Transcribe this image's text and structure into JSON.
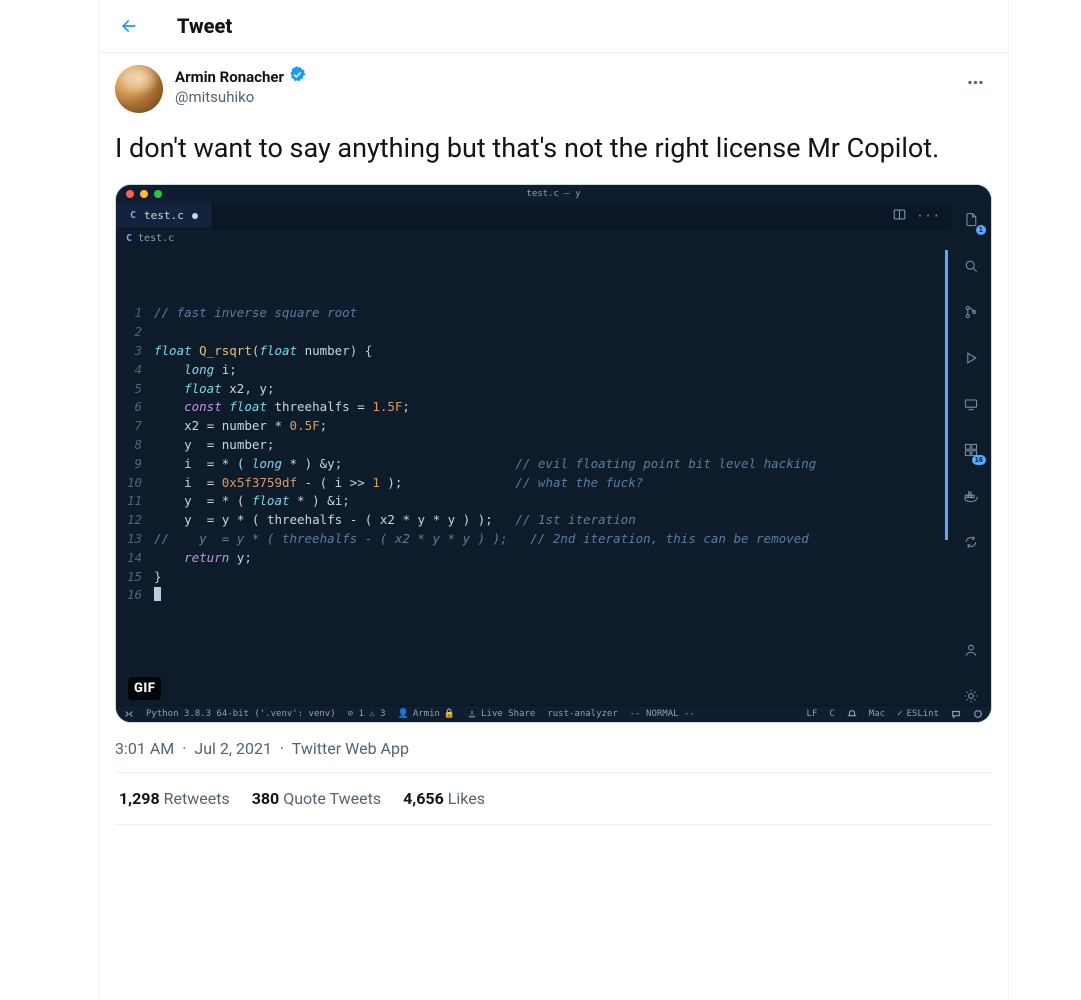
{
  "header": {
    "title": "Tweet"
  },
  "author": {
    "name": "Armin Ronacher",
    "handle": "@mitsuhiko",
    "verified": true
  },
  "tweet_text": "I don't want to say anything but that's not the right license Mr Copilot.",
  "media": {
    "badge": "GIF",
    "window_title": "test.c — y",
    "tab": {
      "lang_badge": "C",
      "filename": "test.c",
      "modified": true
    },
    "breadcrumb": {
      "lang_badge": "C",
      "filename": "test.c"
    },
    "right_rail_badge": "16",
    "status_bar": {
      "remote_icon": true,
      "python": "Python 3.8.3 64-bit ('.venv': venv)",
      "problems": "⊘ 1 ⚠ 3",
      "user": "Armin",
      "live_share": "Live Share",
      "rust": "rust-analyzer",
      "mode": "-- NORMAL --",
      "encoding": "LF",
      "lang": "C",
      "bell_icon": true,
      "mac": "Mac",
      "eslint": "ESLint"
    },
    "code_lines": [
      {
        "n": 1,
        "html": "<span class='cm'>// fast inverse square root</span>"
      },
      {
        "n": 2,
        "html": ""
      },
      {
        "n": 3,
        "html": "<span class='ty'>float</span> <span class='fn'>Q_rsqrt</span>(<span class='ty'>float</span> <span class='id'>number</span>) {"
      },
      {
        "n": 4,
        "html": "    <span class='ty'>long</span> <span class='id'>i</span>;"
      },
      {
        "n": 5,
        "html": "    <span class='ty'>float</span> <span class='id'>x2</span>, <span class='id'>y</span>;"
      },
      {
        "n": 6,
        "html": "    <span class='kw'>const</span> <span class='ty'>float</span> <span class='id'>threehalfs</span> <span class='op'>=</span> <span class='num'>1.5F</span>;"
      },
      {
        "n": 7,
        "html": "    <span class='id'>x2</span> <span class='op'>=</span> <span class='id'>number</span> <span class='op'>*</span> <span class='num'>0.5F</span>;"
      },
      {
        "n": 8,
        "html": "    <span class='id'>y</span>  <span class='op'>=</span> <span class='id'>number</span>;"
      },
      {
        "n": 9,
        "html": "    <span class='id'>i</span>  <span class='op'>=</span> <span class='op'>* (</span> <span class='ty'>long</span> <span class='op'>* ) &amp;</span><span class='id'>y</span>;                       <span class='cm'>// evil floating point bit level hacking</span>"
      },
      {
        "n": 10,
        "html": "    <span class='id'>i</span>  <span class='op'>=</span> <span class='num'>0x5f3759df</span> <span class='op'>- (</span> <span class='id'>i</span> <span class='op'>&gt;&gt;</span> <span class='num'>1</span> <span class='op'>);</span>               <span class='cm'>// what the fuck?</span>"
      },
      {
        "n": 11,
        "html": "    <span class='id'>y</span>  <span class='op'>=</span> <span class='op'>* (</span> <span class='ty'>float</span> <span class='op'>* ) &amp;</span><span class='id'>i</span>;"
      },
      {
        "n": 12,
        "html": "    <span class='id'>y</span>  <span class='op'>=</span> <span class='id'>y</span> <span class='op'>* (</span> <span class='id'>threehalfs</span> <span class='op'>- (</span> <span class='id'>x2</span> <span class='op'>*</span> <span class='id'>y</span> <span class='op'>*</span> <span class='id'>y</span> <span class='op'>) );</span>   <span class='cm'>// 1st iteration</span>"
      },
      {
        "n": 13,
        "html": "<span class='cm'>//    y  = y * ( threehalfs - ( x2 * y * y ) );   // 2nd iteration, this can be removed</span>"
      },
      {
        "n": 14,
        "html": "    <span class='kw'>return</span> <span class='id'>y</span>;"
      },
      {
        "n": 15,
        "html": "}"
      },
      {
        "n": 16,
        "html": "<span class='cursor-block'></span>"
      }
    ]
  },
  "meta": {
    "time": "3:01 AM",
    "date": "Jul 2, 2021",
    "source": "Twitter Web App"
  },
  "stats": {
    "retweets_count": "1,298",
    "retweets_label": "Retweets",
    "quotes_count": "380",
    "quotes_label": "Quote Tweets",
    "likes_count": "4,656",
    "likes_label": "Likes"
  }
}
